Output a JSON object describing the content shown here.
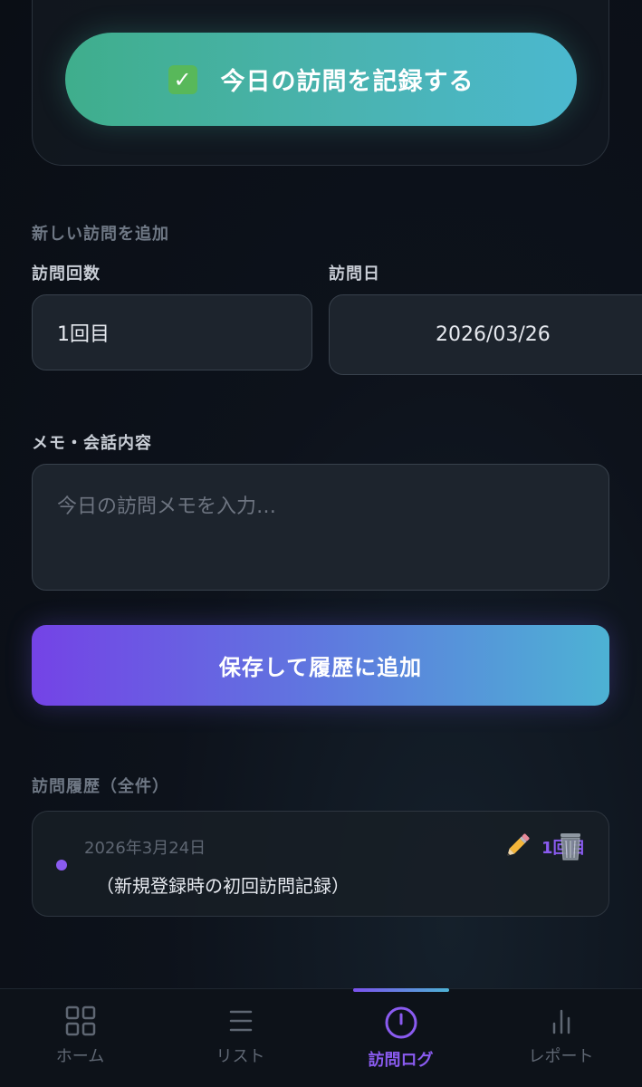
{
  "record_button": {
    "label": "今日の訪問を記録する"
  },
  "new_visit": {
    "section_title": "新しい訪問を追加",
    "count_label": "訪問回数",
    "count_value": "1回目",
    "date_label": "訪問日",
    "date_value": "2026/03/26",
    "memo_label": "メモ・会話内容",
    "memo_placeholder": "今日の訪問メモを入力…",
    "save_label": "保存して履歴に追加"
  },
  "history": {
    "section_title": "訪問履歴（全件）",
    "entries": [
      {
        "date": "2026年3月24日",
        "text": "（新規登録時の初回訪問記録）",
        "count": "1回目"
      }
    ]
  },
  "nav": {
    "items": [
      {
        "label": "ホーム",
        "icon": "grid-icon",
        "active": false
      },
      {
        "label": "リスト",
        "icon": "list-icon",
        "active": false
      },
      {
        "label": "訪問ログ",
        "icon": "clock-icon",
        "active": true
      },
      {
        "label": "レポート",
        "icon": "bar-chart-icon",
        "active": false
      }
    ]
  },
  "colors": {
    "accent_purple": "#8a5bf0",
    "record_gradient_start": "#3fae8c",
    "record_gradient_end": "#4bb8cf",
    "save_gradient_start": "#7443e6",
    "save_gradient_end": "#4db2d4"
  }
}
